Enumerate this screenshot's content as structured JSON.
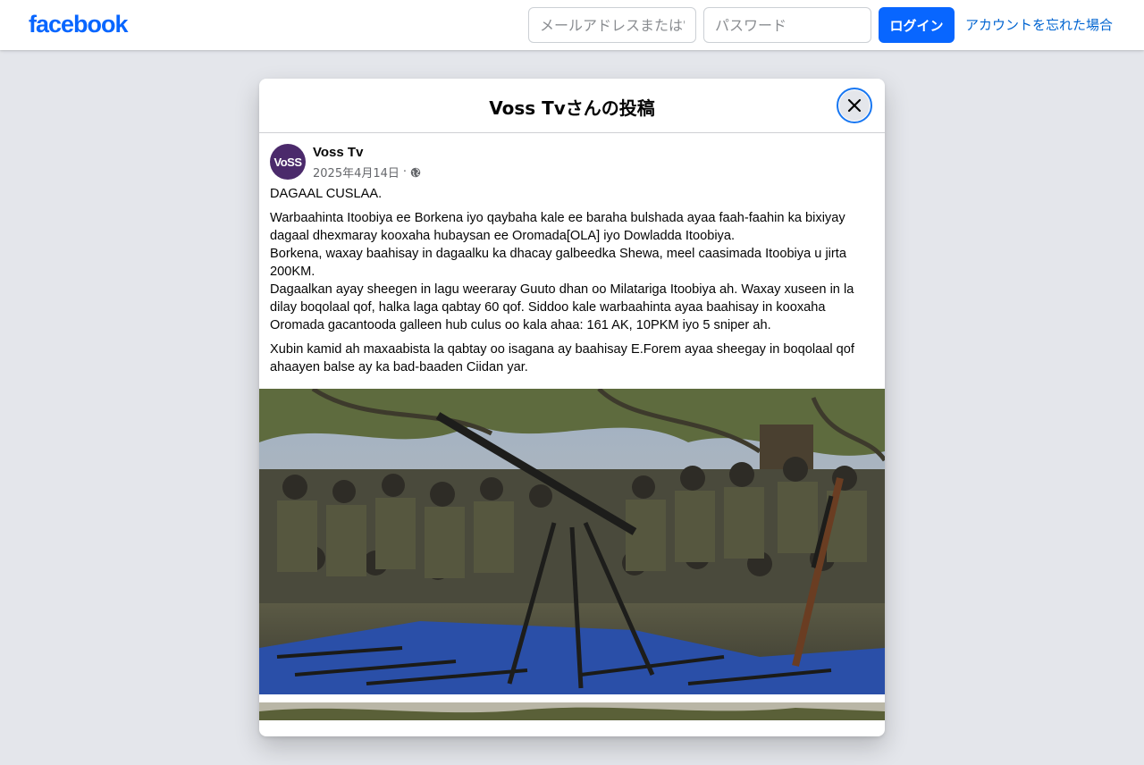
{
  "topbar": {
    "logo": "facebook",
    "email_placeholder": "メールアドレスまたは電話番号",
    "password_placeholder": "パスワード",
    "login_label": "ログイン",
    "forgot_label": "アカウントを忘れた場合"
  },
  "modal": {
    "title": "Voss Tvさんの投稿"
  },
  "post": {
    "author": "Voss Tv",
    "avatar_text": "VoSS",
    "date": "2025年4月14日",
    "separator": "·",
    "paragraphs": [
      "DAGAAL CUSLAA.",
      "Warbaahinta Itoobiya ee Borkena iyo qaybaha kale ee baraha bulshada ayaa faah-faahin ka bixiyay dagaal dhexmaray kooxaha hubaysan ee Oromada[OLA] iyo Dowladda Itoobiya.",
      "Borkena, waxay baahisay in dagaalku ka dhacay galbeedka Shewa, meel caasimada Itoobiya u jirta 200KM.",
      "Dagaalkan ayay sheegen in lagu weeraray Guuto dhan oo Milatariga Itoobiya ah. Waxay xuseen in la dilay boqolaal qof, halka laga qabtay 60 qof. Siddoo kale warbaahinta ayaa baahisay in kooxaha Oromada gacantooda galleen hub culus oo kala ahaa: 161 AK, 10PKM iyo 5 sniper ah.",
      "Xubin kamid ah maxaabista la qabtay oo isagana ay baahisay E.Forem ayaa sheegay in boqolaal qof ahaayen balse ay ka bad-baaden Ciidan yar."
    ]
  },
  "icons": {
    "close": "close-icon",
    "privacy": "globe-icon"
  },
  "colors": {
    "brand": "#0866ff",
    "link": "#0064d1",
    "page_background": "#e4e6eb",
    "focus_ring": "#1877f2"
  }
}
